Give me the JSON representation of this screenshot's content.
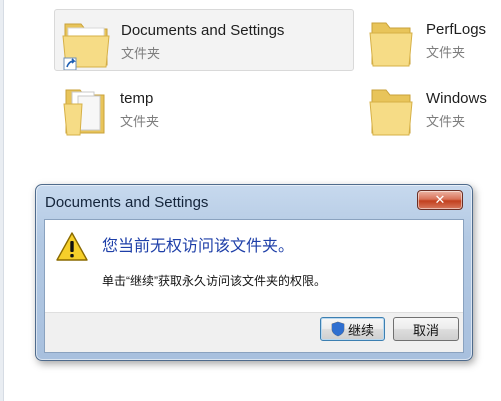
{
  "folders": [
    {
      "name": "Documents and Settings",
      "type": "文件夹",
      "selected": true,
      "shortcut": true
    },
    {
      "name": "PerfLogs",
      "type": "文件夹",
      "selected": false,
      "shortcut": false
    },
    {
      "name": "temp",
      "type": "文件夹",
      "selected": false,
      "shortcut": false
    },
    {
      "name": "Windows",
      "type": "文件夹",
      "selected": false,
      "shortcut": false
    }
  ],
  "dialog": {
    "title": "Documents and Settings",
    "close_glyph": "✕",
    "headline": "您当前无权访问该文件夹。",
    "body": "单击“继续”获取永久访问该文件夹的权限。",
    "icon": "warning-icon",
    "continue_label": "继续",
    "continue_icon": "uac-shield-icon",
    "cancel_label": "取消"
  },
  "colors": {
    "folder_yellow": "#f3d67a",
    "headline_blue": "#1e3fa8",
    "warning_yellow": "#f6cf2a",
    "close_red": "#c2401e"
  }
}
